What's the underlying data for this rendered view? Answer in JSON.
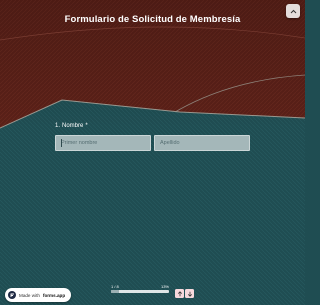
{
  "form": {
    "title": "Formulario de Solicitud de Membresía"
  },
  "question": {
    "number": "1.",
    "label": "Nombre",
    "required_mark": "*"
  },
  "fields": {
    "first_name": {
      "placeholder": "Primer nombre",
      "value": ""
    },
    "last_name": {
      "placeholder": "Apellido",
      "value": ""
    }
  },
  "progress": {
    "step_text": "1 / 8",
    "percent_text": "13%",
    "fraction": 0.13
  },
  "badge": {
    "prefix": "Made with",
    "brand": "forms.app"
  },
  "icons": {
    "collapse": "chevron-up-icon",
    "previous": "arrow-up-icon",
    "next": "arrow-down-icon",
    "logo": "forms-app-logo-icon"
  },
  "colors": {
    "header_background": "#5a2018",
    "body_background": "#1f4d52",
    "input_fill": "#a4b7b9",
    "nav_button": "#f7d9dd"
  }
}
